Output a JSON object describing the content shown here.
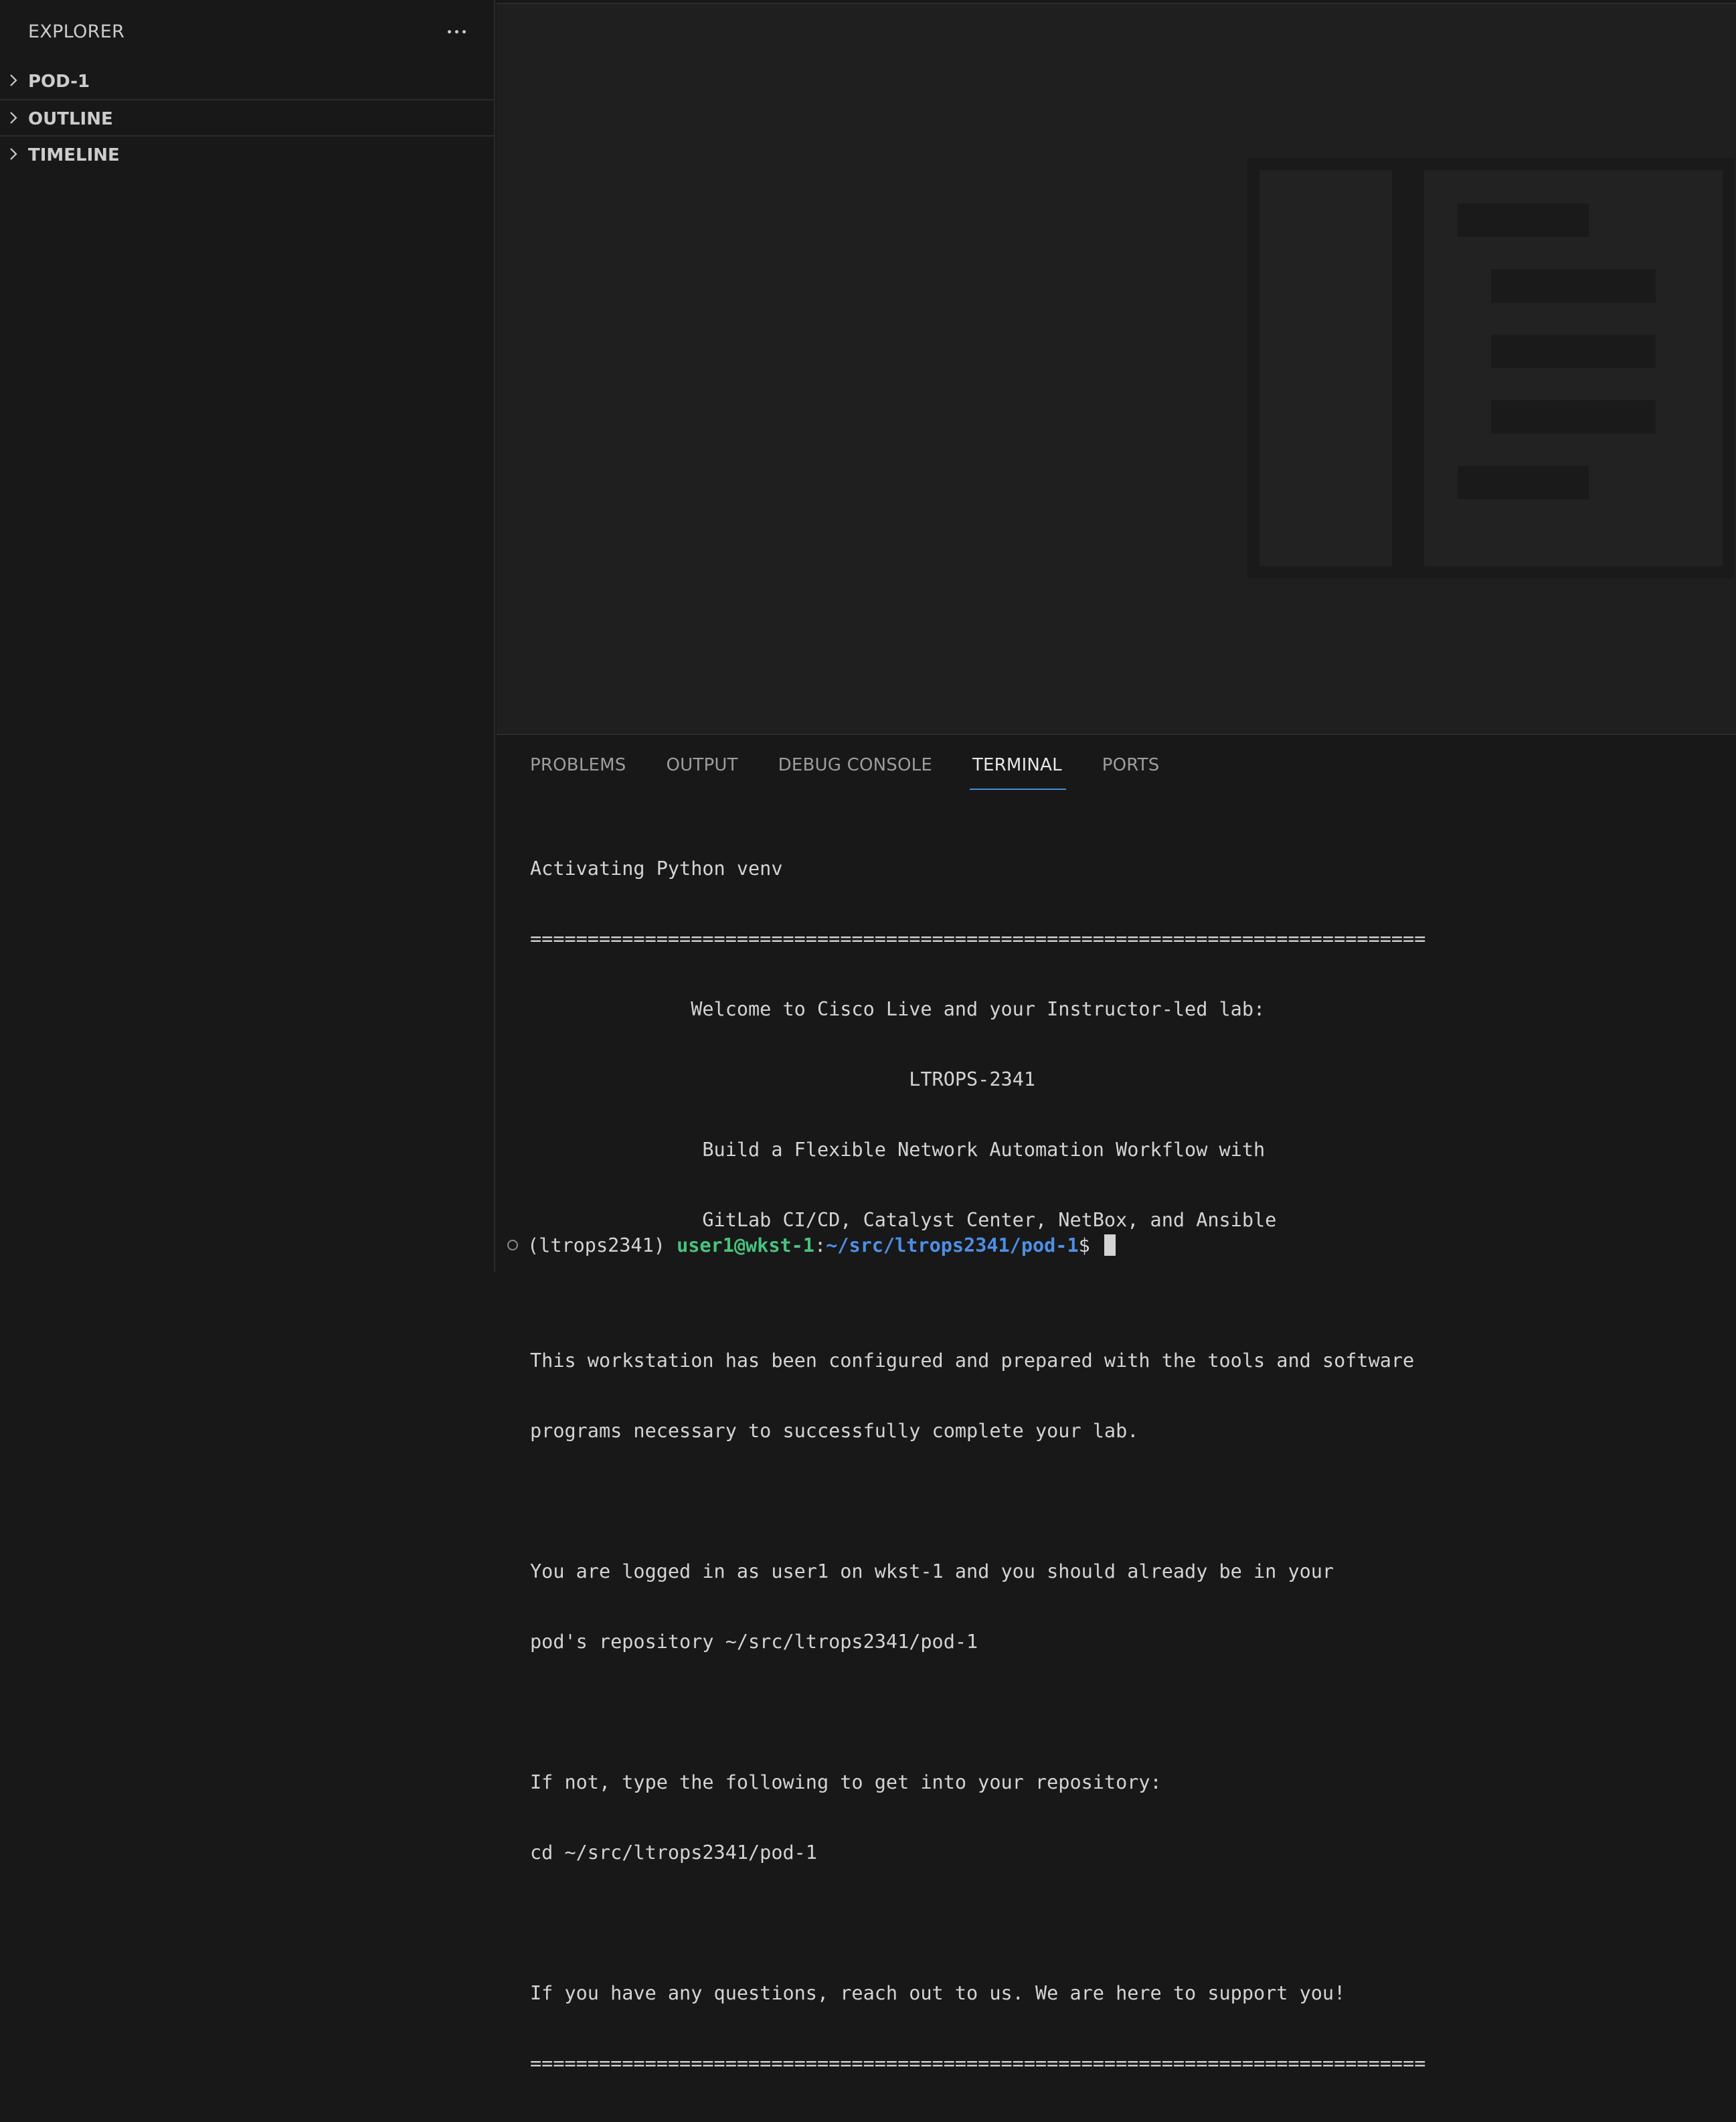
{
  "sidebar": {
    "title": "EXPLORER",
    "sections": [
      {
        "label": "POD-1"
      },
      {
        "label": "OUTLINE"
      },
      {
        "label": "TIMELINE"
      }
    ]
  },
  "panel": {
    "tabs": [
      {
        "label": "PROBLEMS"
      },
      {
        "label": "OUTPUT"
      },
      {
        "label": "DEBUG CONSOLE"
      },
      {
        "label": "TERMINAL"
      },
      {
        "label": "PORTS"
      }
    ],
    "active_tab": "TERMINAL"
  },
  "terminal": {
    "lines": [
      "Activating Python venv",
      "==============================================================================",
      "              Welcome to Cisco Live and your Instructor-led lab:",
      "                                 LTROPS-2341",
      "               Build a Flexible Network Automation Workflow with",
      "               GitLab CI/CD, Catalyst Center, NetBox, and Ansible",
      "",
      "This workstation has been configured and prepared with the tools and software",
      "programs necessary to successfully complete your lab.",
      "",
      "You are logged in as user1 on wkst-1 and you should already be in your",
      "pod's repository ~/src/ltrops2341/pod-1",
      "",
      "If not, type the following to get into your repository:",
      "cd ~/src/ltrops2341/pod-1",
      "",
      "If you have any questions, reach out to us. We are here to support you!",
      "=============================================================================="
    ],
    "prompt": {
      "venv": "(ltrops2341) ",
      "user_host": "user1@wkst-1",
      "separator": ":",
      "path": "~/src/ltrops2341/pod-1",
      "symbol": "$ "
    }
  },
  "colors": {
    "accent": "#4a8bd1",
    "prompt_user": "#47c37f",
    "prompt_path": "#4e8fe6"
  }
}
